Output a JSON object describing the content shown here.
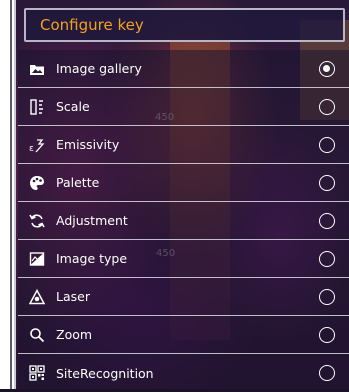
{
  "header": {
    "title": "Configure key"
  },
  "overlay": {
    "marker_text_1": "450",
    "marker_text_2": "450"
  },
  "colors": {
    "accent": "#f2a21e",
    "text": "#ffffff"
  },
  "menu": {
    "items": [
      {
        "label": "Image gallery",
        "icon": "image-gallery-icon",
        "selected": true
      },
      {
        "label": "Scale",
        "icon": "scale-icon",
        "selected": false
      },
      {
        "label": "Emissivity",
        "icon": "emissivity-icon",
        "selected": false
      },
      {
        "label": "Palette",
        "icon": "palette-icon",
        "selected": false
      },
      {
        "label": "Adjustment",
        "icon": "adjustment-icon",
        "selected": false
      },
      {
        "label": "Image type",
        "icon": "image-type-icon",
        "selected": false
      },
      {
        "label": "Laser",
        "icon": "laser-icon",
        "selected": false
      },
      {
        "label": "Zoom",
        "icon": "zoom-icon",
        "selected": false
      },
      {
        "label": "SiteRecognition",
        "icon": "site-recognition-icon",
        "selected": false
      }
    ]
  }
}
